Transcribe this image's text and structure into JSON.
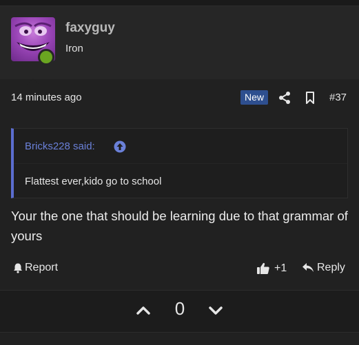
{
  "post": {
    "username": "faxyguy",
    "user_title": "Iron",
    "timestamp": "14 minutes ago",
    "badge": "New",
    "post_number": "#37",
    "quote": {
      "author_line": "Bricks228 said:",
      "text": "Flattest ever,kido go to school"
    },
    "message": "Your the one that should be learning due to that grammar of yours",
    "actions": {
      "report_label": "Report",
      "like_count": "+1",
      "reply_label": "Reply"
    },
    "votes": {
      "score": "0"
    }
  },
  "icons": {
    "share": "share-icon",
    "bookmark": "bookmark-icon",
    "quote_link": "arrow-up-circle-icon",
    "report": "bell-icon",
    "like": "thumbs-up-icon",
    "reply": "reply-arrow-icon",
    "upvote": "chevron-up-icon",
    "downvote": "chevron-down-icon"
  },
  "colors": {
    "background": "#212121",
    "badge": "#2e4f8f",
    "quote_accent": "#5b6dcf",
    "online": "#6aa521",
    "avatar": "#9b46b8"
  }
}
